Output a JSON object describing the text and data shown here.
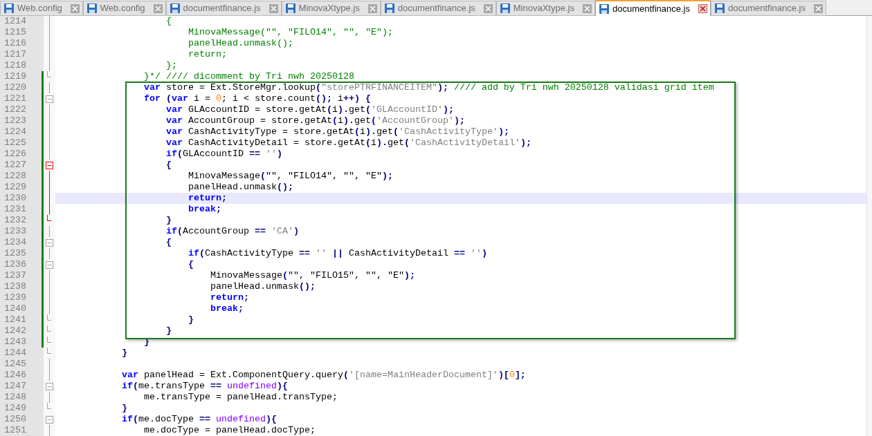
{
  "tabs": [
    {
      "label": "Web.config",
      "selected": false
    },
    {
      "label": "Web.config",
      "selected": false
    },
    {
      "label": "documentfinance.js",
      "selected": false
    },
    {
      "label": "MinovaXtype.js",
      "selected": false
    },
    {
      "label": "documentfinance.js",
      "selected": false
    },
    {
      "label": "MinovaXtype.js",
      "selected": false
    },
    {
      "label": "documentfinance.js",
      "selected": true
    },
    {
      "label": "documentfinance.js",
      "selected": false
    }
  ],
  "lines": [
    {
      "number": "1214",
      "changed": false,
      "current": false,
      "fold_start": false,
      "fold_end": false,
      "active_block": false,
      "tokens": [
        {
          "kind": "comment",
          "text": "                    {"
        }
      ]
    },
    {
      "number": "1215",
      "changed": false,
      "current": false,
      "fold_start": false,
      "fold_end": false,
      "active_block": false,
      "tokens": [
        {
          "kind": "comment",
          "text": "                        MinovaMessage(\"\", \"FILO14\", \"\", \"E\");"
        }
      ]
    },
    {
      "number": "1216",
      "changed": false,
      "current": false,
      "fold_start": false,
      "fold_end": false,
      "active_block": false,
      "tokens": [
        {
          "kind": "comment",
          "text": "                        panelHead.unmask();"
        }
      ]
    },
    {
      "number": "1217",
      "changed": false,
      "current": false,
      "fold_start": false,
      "fold_end": false,
      "active_block": false,
      "tokens": [
        {
          "kind": "comment",
          "text": "                        return;"
        }
      ]
    },
    {
      "number": "1218",
      "changed": false,
      "current": false,
      "fold_start": false,
      "fold_end": false,
      "active_block": false,
      "tokens": [
        {
          "kind": "comment",
          "text": "                    };"
        }
      ]
    },
    {
      "number": "1219",
      "changed": true,
      "current": false,
      "fold_start": false,
      "fold_end": true,
      "active_block": false,
      "tokens": [
        {
          "kind": "comment",
          "text": "                }*/ //// dicomment by Tri nwh 20250128"
        }
      ]
    },
    {
      "number": "1220",
      "changed": true,
      "current": false,
      "fold_start": false,
      "fold_end": false,
      "active_block": false,
      "tokens": [
        {
          "kind": "keyword",
          "text": "                var"
        },
        {
          "kind": "plain",
          "text": " store = Ext.StoreMgr.lookup"
        },
        {
          "kind": "operator",
          "text": "("
        },
        {
          "kind": "string",
          "text": "\"storePTRFINANCEITEM\""
        },
        {
          "kind": "operator",
          "text": ");"
        },
        {
          "kind": "comment",
          "text": " //// add by Tri nwh 20250128 validasi grid item"
        }
      ]
    },
    {
      "number": "1221",
      "changed": true,
      "current": false,
      "fold_start": true,
      "fold_end": false,
      "active_block": false,
      "tokens": [
        {
          "kind": "keyword",
          "text": "                for"
        },
        {
          "kind": "operator",
          "text": " ("
        },
        {
          "kind": "keyword",
          "text": "var"
        },
        {
          "kind": "plain",
          "text": " i = "
        },
        {
          "kind": "number",
          "text": "0"
        },
        {
          "kind": "plain",
          "text": "; i < store.count"
        },
        {
          "kind": "operator",
          "text": "();"
        },
        {
          "kind": "plain",
          "text": " i"
        },
        {
          "kind": "operator",
          "text": "++) {"
        }
      ]
    },
    {
      "number": "1222",
      "changed": true,
      "current": false,
      "fold_start": false,
      "fold_end": false,
      "active_block": false,
      "tokens": [
        {
          "kind": "keyword",
          "text": "                    var"
        },
        {
          "kind": "plain",
          "text": " GLAccountID = store.getAt"
        },
        {
          "kind": "operator",
          "text": "("
        },
        {
          "kind": "plain",
          "text": "i"
        },
        {
          "kind": "operator",
          "text": ")."
        },
        {
          "kind": "plain",
          "text": "get"
        },
        {
          "kind": "operator",
          "text": "("
        },
        {
          "kind": "string",
          "text": "'GLAccountID'"
        },
        {
          "kind": "operator",
          "text": ");"
        }
      ]
    },
    {
      "number": "1223",
      "changed": true,
      "current": false,
      "fold_start": false,
      "fold_end": false,
      "active_block": false,
      "tokens": [
        {
          "kind": "keyword",
          "text": "                    var"
        },
        {
          "kind": "plain",
          "text": " AccountGroup = store.getAt"
        },
        {
          "kind": "operator",
          "text": "("
        },
        {
          "kind": "plain",
          "text": "i"
        },
        {
          "kind": "operator",
          "text": ")."
        },
        {
          "kind": "plain",
          "text": "get"
        },
        {
          "kind": "operator",
          "text": "("
        },
        {
          "kind": "string",
          "text": "'AccountGroup'"
        },
        {
          "kind": "operator",
          "text": ");"
        }
      ]
    },
    {
      "number": "1224",
      "changed": true,
      "current": false,
      "fold_start": false,
      "fold_end": false,
      "active_block": false,
      "tokens": [
        {
          "kind": "keyword",
          "text": "                    var"
        },
        {
          "kind": "plain",
          "text": " CashActivityType = store.getAt"
        },
        {
          "kind": "operator",
          "text": "("
        },
        {
          "kind": "plain",
          "text": "i"
        },
        {
          "kind": "operator",
          "text": ")."
        },
        {
          "kind": "plain",
          "text": "get"
        },
        {
          "kind": "operator",
          "text": "("
        },
        {
          "kind": "string",
          "text": "'CashActivityType'"
        },
        {
          "kind": "operator",
          "text": ");"
        }
      ]
    },
    {
      "number": "1225",
      "changed": true,
      "current": false,
      "fold_start": false,
      "fold_end": false,
      "active_block": false,
      "tokens": [
        {
          "kind": "keyword",
          "text": "                    var"
        },
        {
          "kind": "plain",
          "text": " CashActivityDetail = store.getAt"
        },
        {
          "kind": "operator",
          "text": "("
        },
        {
          "kind": "plain",
          "text": "i"
        },
        {
          "kind": "operator",
          "text": ")."
        },
        {
          "kind": "plain",
          "text": "get"
        },
        {
          "kind": "operator",
          "text": "("
        },
        {
          "kind": "string",
          "text": "'CashActivityDetail'"
        },
        {
          "kind": "operator",
          "text": ");"
        }
      ]
    },
    {
      "number": "1226",
      "changed": true,
      "current": false,
      "fold_start": false,
      "fold_end": false,
      "active_block": false,
      "tokens": [
        {
          "kind": "keyword",
          "text": "                    if"
        },
        {
          "kind": "operator",
          "text": "("
        },
        {
          "kind": "plain",
          "text": "GLAccountID "
        },
        {
          "kind": "operator",
          "text": "== "
        },
        {
          "kind": "string",
          "text": "''"
        },
        {
          "kind": "operator",
          "text": ")"
        }
      ]
    },
    {
      "number": "1227",
      "changed": true,
      "current": false,
      "fold_start": true,
      "fold_end": false,
      "active_block": true,
      "tokens": [
        {
          "kind": "operator",
          "text": "                    {"
        }
      ]
    },
    {
      "number": "1228",
      "changed": true,
      "current": false,
      "fold_start": false,
      "fold_end": false,
      "active_block": true,
      "tokens": [
        {
          "kind": "plain",
          "text": "                        MinovaMessage"
        },
        {
          "kind": "operator",
          "text": "("
        },
        {
          "kind": "plain",
          "text": "\"\", \"FILO14\", \"\", \"E\""
        },
        {
          "kind": "operator",
          "text": ");"
        }
      ]
    },
    {
      "number": "1229",
      "changed": true,
      "current": false,
      "fold_start": false,
      "fold_end": false,
      "active_block": true,
      "tokens": [
        {
          "kind": "plain",
          "text": "                        panelHead.unmask"
        },
        {
          "kind": "operator",
          "text": "();"
        }
      ]
    },
    {
      "number": "1230",
      "changed": true,
      "current": true,
      "fold_start": false,
      "fold_end": false,
      "active_block": true,
      "tokens": [
        {
          "kind": "keyword",
          "text": "                        return"
        },
        {
          "kind": "operator",
          "text": ";"
        }
      ]
    },
    {
      "number": "1231",
      "changed": true,
      "current": false,
      "fold_start": false,
      "fold_end": false,
      "active_block": true,
      "tokens": [
        {
          "kind": "keyword",
          "text": "                        break"
        },
        {
          "kind": "operator",
          "text": ";"
        }
      ]
    },
    {
      "number": "1232",
      "changed": true,
      "current": false,
      "fold_start": false,
      "fold_end": true,
      "active_block": true,
      "tokens": [
        {
          "kind": "operator",
          "text": "                    }"
        }
      ]
    },
    {
      "number": "1233",
      "changed": true,
      "current": false,
      "fold_start": false,
      "fold_end": false,
      "active_block": false,
      "tokens": [
        {
          "kind": "keyword",
          "text": "                    if"
        },
        {
          "kind": "operator",
          "text": "("
        },
        {
          "kind": "plain",
          "text": "AccountGroup "
        },
        {
          "kind": "operator",
          "text": "== "
        },
        {
          "kind": "string",
          "text": "'CA'"
        },
        {
          "kind": "operator",
          "text": ")"
        }
      ]
    },
    {
      "number": "1234",
      "changed": true,
      "current": false,
      "fold_start": true,
      "fold_end": false,
      "active_block": false,
      "tokens": [
        {
          "kind": "operator",
          "text": "                    {"
        }
      ]
    },
    {
      "number": "1235",
      "changed": true,
      "current": false,
      "fold_start": false,
      "fold_end": false,
      "active_block": false,
      "tokens": [
        {
          "kind": "keyword",
          "text": "                        if"
        },
        {
          "kind": "operator",
          "text": "("
        },
        {
          "kind": "plain",
          "text": "CashActivityType "
        },
        {
          "kind": "operator",
          "text": "== "
        },
        {
          "kind": "string",
          "text": "''"
        },
        {
          "kind": "operator",
          "text": " || "
        },
        {
          "kind": "plain",
          "text": "CashActivityDetail "
        },
        {
          "kind": "operator",
          "text": "== "
        },
        {
          "kind": "string",
          "text": "''"
        },
        {
          "kind": "operator",
          "text": ")"
        }
      ]
    },
    {
      "number": "1236",
      "changed": true,
      "current": false,
      "fold_start": true,
      "fold_end": false,
      "active_block": false,
      "tokens": [
        {
          "kind": "operator",
          "text": "                        {"
        }
      ]
    },
    {
      "number": "1237",
      "changed": true,
      "current": false,
      "fold_start": false,
      "fold_end": false,
      "active_block": false,
      "tokens": [
        {
          "kind": "plain",
          "text": "                            MinovaMessage"
        },
        {
          "kind": "operator",
          "text": "("
        },
        {
          "kind": "plain",
          "text": "\"\", \"FILO15\", \"\", \"E\""
        },
        {
          "kind": "operator",
          "text": ");"
        }
      ]
    },
    {
      "number": "1238",
      "changed": true,
      "current": false,
      "fold_start": false,
      "fold_end": false,
      "active_block": false,
      "tokens": [
        {
          "kind": "plain",
          "text": "                            panelHead.unmask"
        },
        {
          "kind": "operator",
          "text": "();"
        }
      ]
    },
    {
      "number": "1239",
      "changed": true,
      "current": false,
      "fold_start": false,
      "fold_end": false,
      "active_block": false,
      "tokens": [
        {
          "kind": "keyword",
          "text": "                            return"
        },
        {
          "kind": "operator",
          "text": ";"
        }
      ]
    },
    {
      "number": "1240",
      "changed": true,
      "current": false,
      "fold_start": false,
      "fold_end": false,
      "active_block": false,
      "tokens": [
        {
          "kind": "keyword",
          "text": "                            break"
        },
        {
          "kind": "operator",
          "text": ";"
        }
      ]
    },
    {
      "number": "1241",
      "changed": true,
      "current": false,
      "fold_start": false,
      "fold_end": true,
      "active_block": false,
      "tokens": [
        {
          "kind": "operator",
          "text": "                        }"
        }
      ]
    },
    {
      "number": "1242",
      "changed": true,
      "current": false,
      "fold_start": false,
      "fold_end": true,
      "active_block": false,
      "tokens": [
        {
          "kind": "operator",
          "text": "                    }"
        }
      ]
    },
    {
      "number": "1243",
      "changed": true,
      "current": false,
      "fold_start": false,
      "fold_end": true,
      "active_block": false,
      "tokens": [
        {
          "kind": "operator",
          "text": "                }"
        }
      ]
    },
    {
      "number": "1244",
      "changed": false,
      "current": false,
      "fold_start": false,
      "fold_end": true,
      "active_block": false,
      "tokens": [
        {
          "kind": "operator",
          "text": "            }"
        }
      ]
    },
    {
      "number": "1245",
      "changed": false,
      "current": false,
      "fold_start": false,
      "fold_end": false,
      "active_block": false
    },
    {
      "number": "1246",
      "changed": false,
      "current": false,
      "fold_start": false,
      "fold_end": false,
      "active_block": false,
      "tokens": [
        {
          "kind": "keyword",
          "text": "            var"
        },
        {
          "kind": "plain",
          "text": " panelHead = Ext.ComponentQuery.query"
        },
        {
          "kind": "operator",
          "text": "("
        },
        {
          "kind": "string",
          "text": "'[name=MainHeaderDocument]'"
        },
        {
          "kind": "operator",
          "text": ")["
        },
        {
          "kind": "number",
          "text": "0"
        },
        {
          "kind": "operator",
          "text": "];"
        }
      ]
    },
    {
      "number": "1247",
      "changed": false,
      "current": false,
      "fold_start": true,
      "fold_end": false,
      "active_block": false,
      "tokens": [
        {
          "kind": "keyword",
          "text": "            if"
        },
        {
          "kind": "operator",
          "text": "("
        },
        {
          "kind": "plain",
          "text": "me.transType "
        },
        {
          "kind": "operator",
          "text": "== "
        },
        {
          "kind": "constant",
          "text": "undefined"
        },
        {
          "kind": "operator",
          "text": "){"
        }
      ]
    },
    {
      "number": "1248",
      "changed": false,
      "current": false,
      "fold_start": false,
      "fold_end": false,
      "active_block": false,
      "tokens": [
        {
          "kind": "plain",
          "text": "                me.transType = panelHead.transType;"
        }
      ]
    },
    {
      "number": "1249",
      "changed": false,
      "current": false,
      "fold_start": false,
      "fold_end": true,
      "active_block": false,
      "tokens": [
        {
          "kind": "operator",
          "text": "            }"
        }
      ]
    },
    {
      "number": "1250",
      "changed": false,
      "current": false,
      "fold_start": true,
      "fold_end": false,
      "active_block": false,
      "tokens": [
        {
          "kind": "keyword",
          "text": "            if"
        },
        {
          "kind": "operator",
          "text": "("
        },
        {
          "kind": "plain",
          "text": "me.docType "
        },
        {
          "kind": "operator",
          "text": "== "
        },
        {
          "kind": "constant",
          "text": "undefined"
        },
        {
          "kind": "operator",
          "text": "){"
        }
      ]
    },
    {
      "number": "1251",
      "changed": false,
      "current": false,
      "fold_start": false,
      "fold_end": false,
      "active_block": false,
      "tokens": [
        {
          "kind": "plain",
          "text": "                me.docType = panelHead.docType;"
        }
      ]
    }
  ]
}
